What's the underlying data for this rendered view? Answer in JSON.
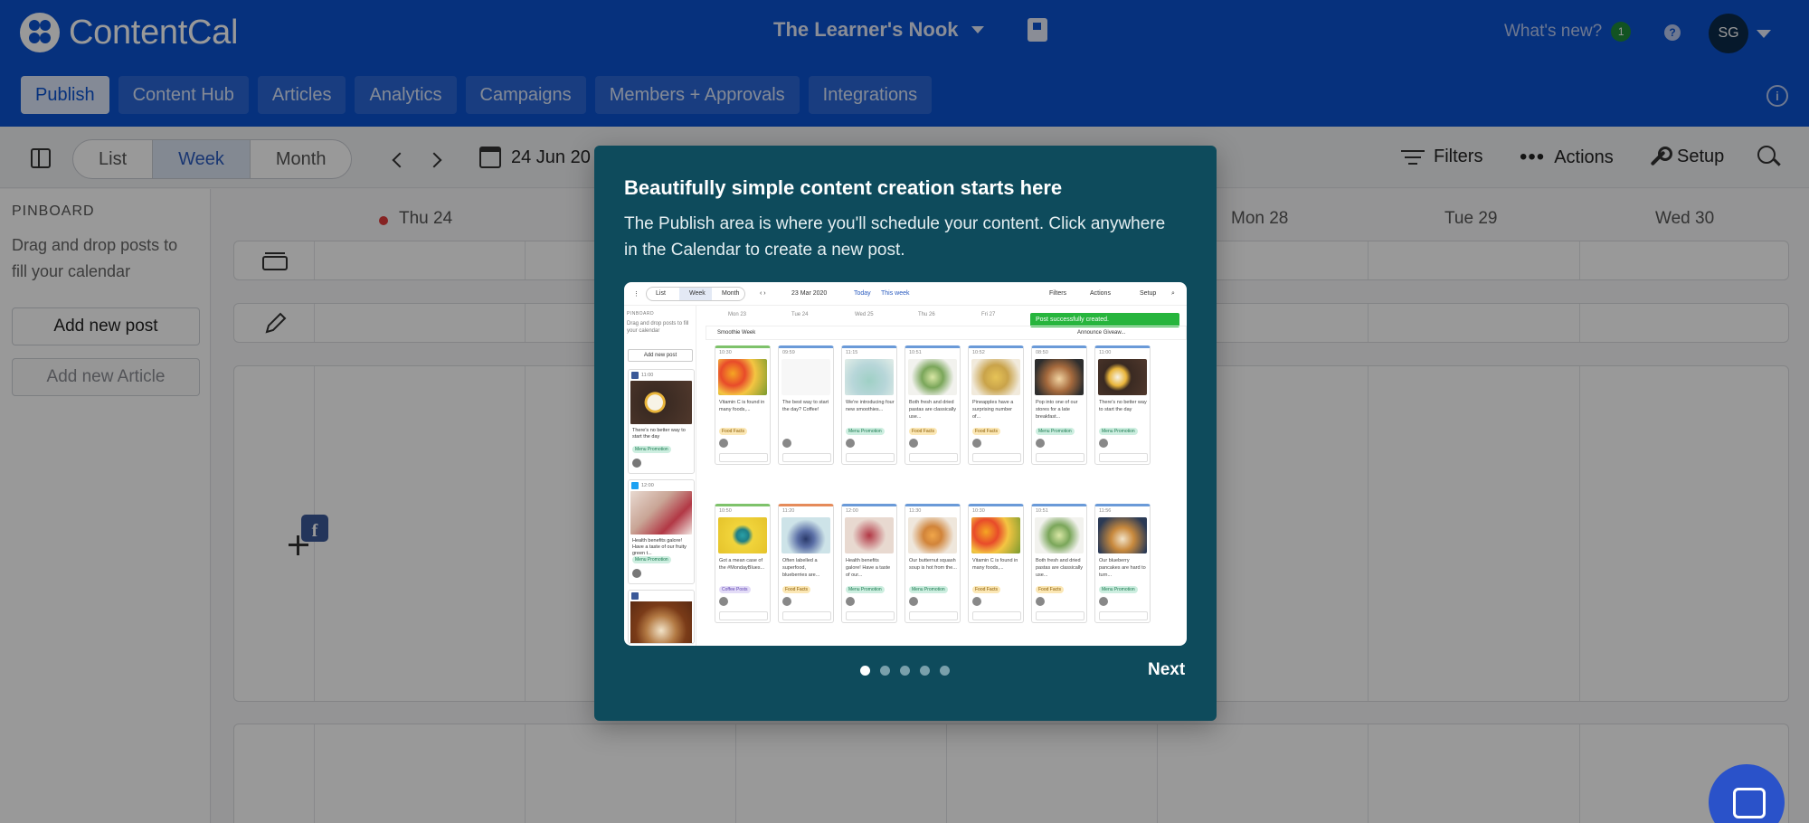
{
  "header": {
    "brand": "ContentCal",
    "workspace": "The Learner's Nook",
    "whats_new": "What's new?",
    "whats_new_count": "1",
    "help": "?",
    "avatar_initials": "SG",
    "info": "i"
  },
  "nav_tabs": [
    {
      "label": "Publish",
      "active": true
    },
    {
      "label": "Content Hub"
    },
    {
      "label": "Articles"
    },
    {
      "label": "Analytics"
    },
    {
      "label": "Campaigns"
    },
    {
      "label": "Members + Approvals"
    },
    {
      "label": "Integrations"
    }
  ],
  "toolbar": {
    "views": [
      "List",
      "Week",
      "Month"
    ],
    "active_view": "Week",
    "date": "24 Jun 20",
    "filters": "Filters",
    "actions": "Actions",
    "setup": "Setup"
  },
  "sidebar": {
    "title": "PINBOARD",
    "description": "Drag and drop posts to fill your calendar",
    "add_post": "Add new post",
    "add_article": "Add new Article"
  },
  "calendar": {
    "days": [
      "Thu 24",
      "Mon 28",
      "Tue 29",
      "Wed 30"
    ]
  },
  "modal": {
    "title": "Beautifully simple content creation starts here",
    "body": "The Publish area is where you'll schedule your content. Click anywhere in the Calendar to create a new post.",
    "next": "Next",
    "pages": 5,
    "current_page": 1
  },
  "preview": {
    "toolbar": [
      "List",
      "Week",
      "Month",
      "23 Mar 2020",
      "Today",
      "This week",
      "Filters",
      "Actions",
      "Setup"
    ],
    "pinboard": "PINBOARD",
    "pinboard_desc": "Drag and drop posts to fill your calendar",
    "add_post": "Add new post",
    "days": [
      "Mon 23",
      "Tue 24",
      "Wed 25",
      "Thu 26",
      "Fri 27"
    ],
    "toast": "Post successfully created.",
    "strip_labels": [
      "Smoothie Week",
      "Announce Giveaw..."
    ],
    "side_posts": [
      {
        "time": "11:00",
        "text": "There's no better way to start the day",
        "tag": "Menu Promotion"
      },
      {
        "time": "12:00",
        "text": "Health benefits galore! Have a taste of our fruity green t...",
        "tag": "Menu Promotion"
      }
    ],
    "row1": [
      {
        "time": "10:30",
        "text": "Vitamin C is found in many foods,...",
        "tag": "Food Facts"
      },
      {
        "time": "09:59",
        "text": "The best way to start the day? Coffee!",
        "tag": ""
      },
      {
        "time": "11:15",
        "text": "We're introducing four new smoothies...",
        "tag": "Menu Promotion"
      },
      {
        "time": "10:51",
        "text": "Both fresh and dried pastas are classically use...",
        "tag": "Food Facts"
      },
      {
        "time": "10:52",
        "text": "Pineapples have a surprising number of...",
        "tag": "Food Facts"
      },
      {
        "time": "08:50",
        "text": "Pop into one of our stores for a late breakfast...",
        "tag": "Menu Promotion"
      },
      {
        "time": "11:00",
        "text": "There's no better way to start the day",
        "tag": "Menu Promotion"
      }
    ],
    "row2": [
      {
        "time": "10:50",
        "text": "Got a mean case of the #MondayBlues...",
        "tag": "Coffee Posts"
      },
      {
        "time": "11:20",
        "text": "Often labelled a superfood, blueberries are...",
        "tag": "Food Facts"
      },
      {
        "time": "12:00",
        "text": "Health benefits galore! Have a taste of our...",
        "tag": "Menu Promotion"
      },
      {
        "time": "11:30",
        "text": "Our butternut squash soup is hot from the...",
        "tag": "Menu Promotion"
      },
      {
        "time": "10:30",
        "text": "Vitamin C is found in many foods,...",
        "tag": "Food Facts"
      },
      {
        "time": "10:51",
        "text": "Both fresh and dried pastas are classically use...",
        "tag": "Food Facts"
      },
      {
        "time": "11:56",
        "text": "Our blueberry pancakes are hard to turn...",
        "tag": "Menu Promotion"
      }
    ]
  },
  "colors": {
    "brand_blue": "#0a52d0",
    "modal_bg": "#0e4b5c",
    "facebook": "#3b5998",
    "toast_green": "#27b53d"
  }
}
